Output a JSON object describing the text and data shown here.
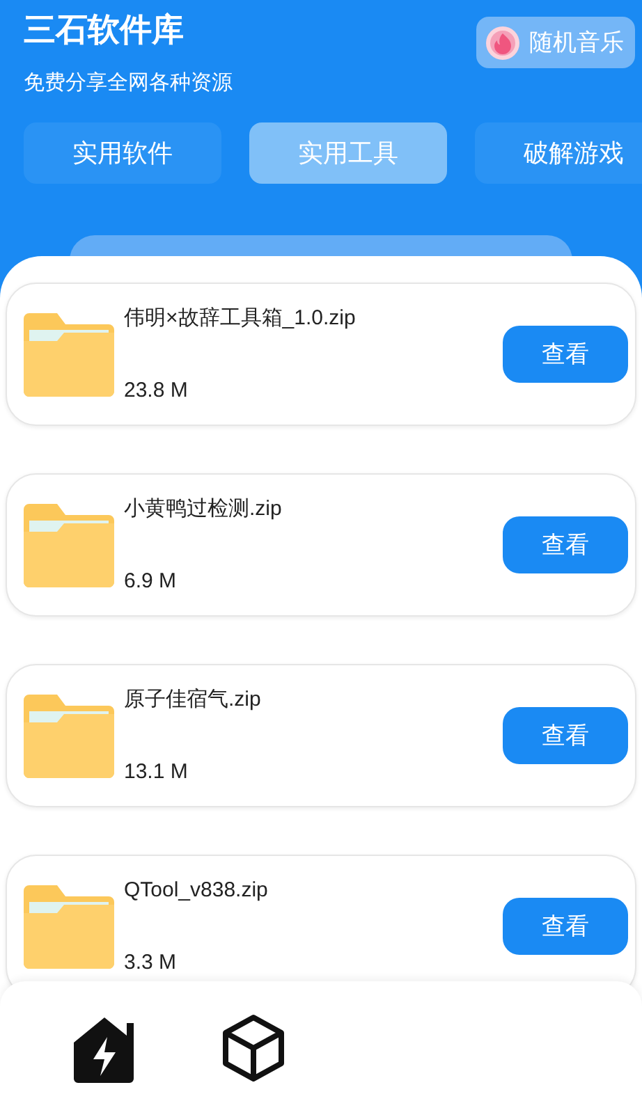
{
  "header": {
    "title": "三石软件库",
    "subtitle": "免费分享全网各种资源",
    "music_button": "随机音乐"
  },
  "tabs": [
    {
      "label": "实用软件",
      "selected": false
    },
    {
      "label": "实用工具",
      "selected": true
    },
    {
      "label": "破解游戏",
      "selected": false
    }
  ],
  "files": [
    {
      "name": "伟明×故辞工具箱_1.0.zip",
      "size": "23.8 M",
      "button": "查看"
    },
    {
      "name": "小黄鸭过检测.zip",
      "size": "6.9 M",
      "button": "查看"
    },
    {
      "name": "原子佳宿气.zip",
      "size": "13.1 M",
      "button": "查看"
    },
    {
      "name": "QTool_v838.zip",
      "size": "3.3 M",
      "button": "查看"
    }
  ],
  "nav": [
    {
      "kind": "home",
      "selected": true
    },
    {
      "kind": "cube",
      "selected": false
    }
  ]
}
